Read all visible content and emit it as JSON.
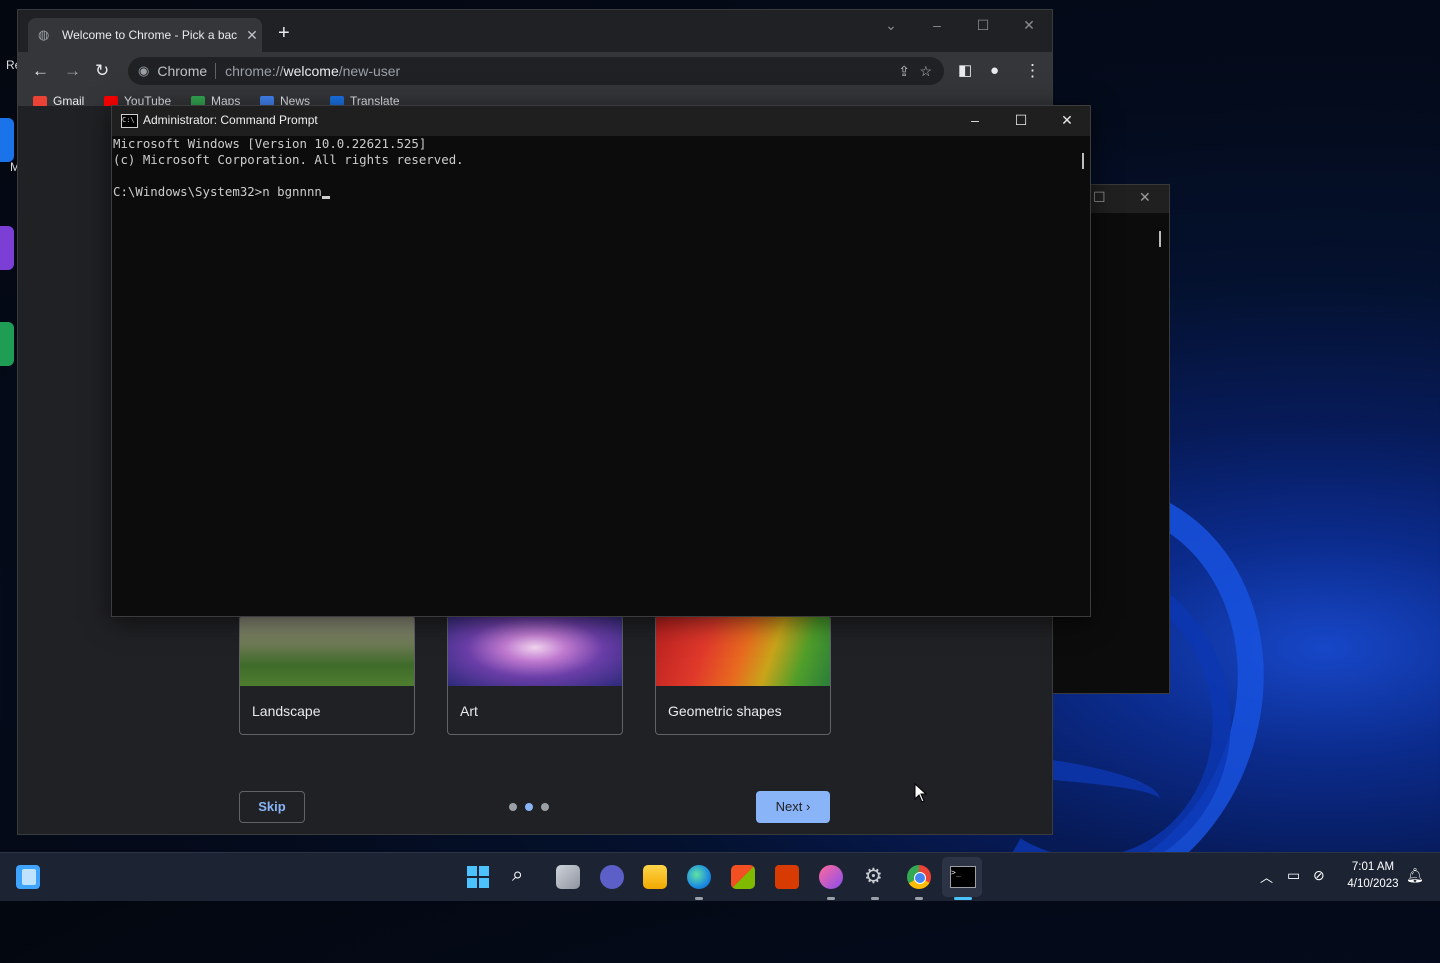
{
  "desktop": {
    "partial_label": "Re",
    "partial_label_2": "M"
  },
  "chrome": {
    "tab_title": "Welcome to Chrome - Pick a bac",
    "omnibox_chip": "Chrome",
    "url_prefix": "chrome://",
    "url_host": "welcome",
    "url_path": "/new-user",
    "bookmarks": [
      "Gmail",
      "YouTube",
      "Maps",
      "News",
      "Translate"
    ],
    "cards": [
      {
        "label": "Landscape"
      },
      {
        "label": "Art"
      },
      {
        "label": "Geometric shapes"
      }
    ],
    "skip_label": "Skip",
    "next_label": "Next",
    "page_dots": {
      "count": 3,
      "active": 2
    }
  },
  "cmd": {
    "title": "Administrator: Command Prompt",
    "line1": "Microsoft Windows [Version 10.0.22621.525]",
    "line2": "(c) Microsoft Corporation. All rights reserved.",
    "prompt": "C:\\Windows\\System32>",
    "typed": "n bgnnnn"
  },
  "taskbar": {
    "time": "7:01 AM",
    "date": "4/10/2023"
  },
  "colors": {
    "accent_blue": "#8ab4f8",
    "chrome_bg": "#202124",
    "cmd_bg": "#0c0c0c",
    "taskbar_bg": "#1c2433"
  }
}
